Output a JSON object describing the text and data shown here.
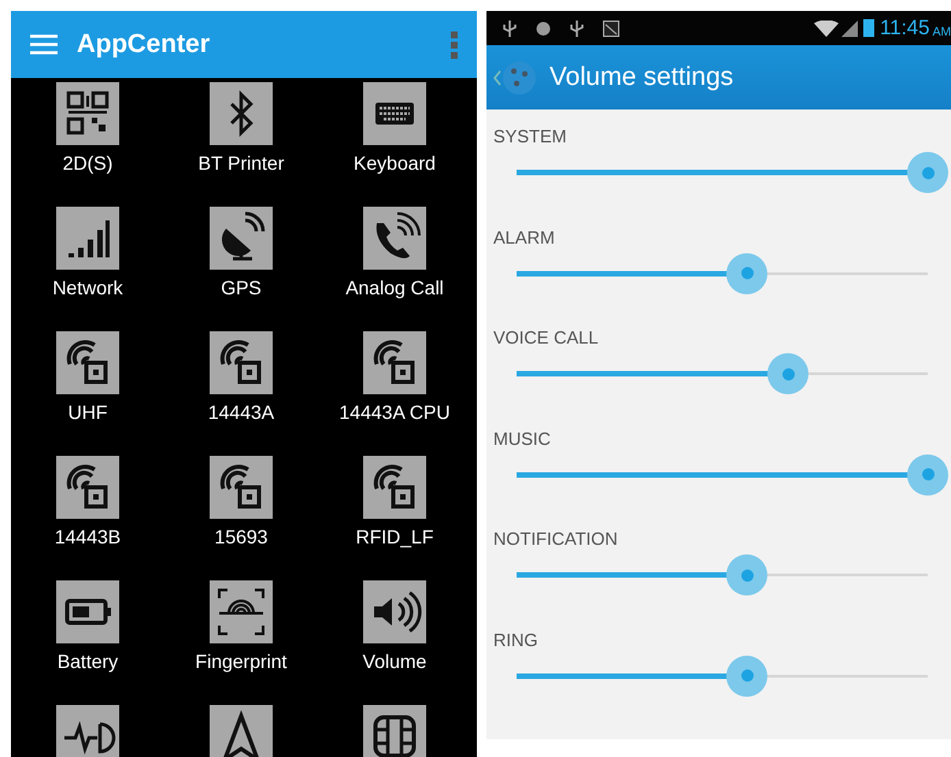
{
  "app_center": {
    "title": "AppCenter",
    "apps": [
      {
        "label": "2D(S)"
      },
      {
        "label": "BT Printer"
      },
      {
        "label": "Keyboard"
      },
      {
        "label": "Network"
      },
      {
        "label": "GPS"
      },
      {
        "label": "Analog Call"
      },
      {
        "label": "UHF"
      },
      {
        "label": "14443A"
      },
      {
        "label": "14443A CPU"
      },
      {
        "label": "14443B"
      },
      {
        "label": "15693"
      },
      {
        "label": "RFID_LF"
      },
      {
        "label": "Battery"
      },
      {
        "label": "Fingerprint"
      },
      {
        "label": "Volume"
      }
    ]
  },
  "status_bar": {
    "time": "11:45",
    "meridiem": "AM"
  },
  "volume_settings": {
    "title": "Volume settings",
    "channels": [
      {
        "name": "SYSTEM",
        "level": 1.0
      },
      {
        "name": "ALARM",
        "level": 0.56
      },
      {
        "name": "VOICE CALL",
        "level": 0.66
      },
      {
        "name": "MUSIC",
        "level": 1.0
      },
      {
        "name": "NOTIFICATION",
        "level": 0.56
      },
      {
        "name": "RING",
        "level": 0.56
      }
    ]
  }
}
